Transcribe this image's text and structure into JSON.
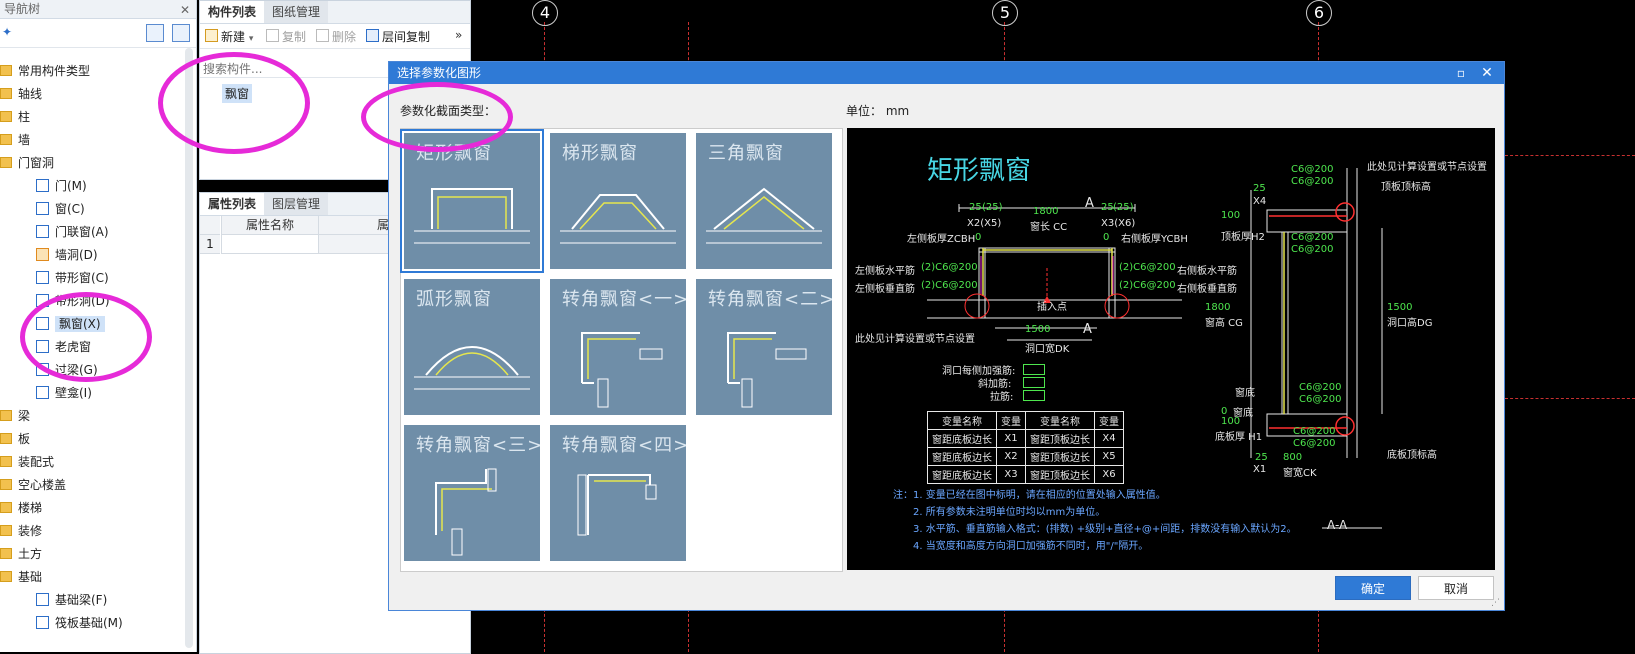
{
  "nav": {
    "title": "导航树",
    "tree": [
      {
        "label": "常用构件类型",
        "kind": "folder"
      },
      {
        "label": "轴线",
        "kind": "folder"
      },
      {
        "label": "柱",
        "kind": "folder"
      },
      {
        "label": "墙",
        "kind": "folder"
      },
      {
        "label": "门窗洞",
        "kind": "folder-open"
      },
      {
        "label": "门(M)",
        "kind": "item"
      },
      {
        "label": "窗(C)",
        "kind": "item"
      },
      {
        "label": "门联窗(A)",
        "kind": "item"
      },
      {
        "label": "墙洞(D)",
        "kind": "item-orange"
      },
      {
        "label": "带形窗(C)",
        "kind": "item"
      },
      {
        "label": "带形洞(D)",
        "kind": "item"
      },
      {
        "label": "飘窗(X)",
        "kind": "item",
        "selected": true
      },
      {
        "label": "老虎窗",
        "kind": "item"
      },
      {
        "label": "过梁(G)",
        "kind": "item"
      },
      {
        "label": "壁龛(I)",
        "kind": "item"
      },
      {
        "label": "梁",
        "kind": "folder"
      },
      {
        "label": "板",
        "kind": "folder"
      },
      {
        "label": "装配式",
        "kind": "folder"
      },
      {
        "label": "空心楼盖",
        "kind": "folder"
      },
      {
        "label": "楼梯",
        "kind": "folder"
      },
      {
        "label": "装修",
        "kind": "folder"
      },
      {
        "label": "土方",
        "kind": "folder"
      },
      {
        "label": "基础",
        "kind": "folder-open"
      },
      {
        "label": "基础梁(F)",
        "kind": "item"
      },
      {
        "label": "筏板基础(M)",
        "kind": "item"
      }
    ]
  },
  "component_panel": {
    "tabs": [
      "构件列表",
      "图纸管理"
    ],
    "toolbar": {
      "new": "新建",
      "copy": "复制",
      "delete": "删除",
      "floor_copy": "层间复制",
      "more": "»"
    },
    "search_placeholder": "搜索构件...",
    "items": [
      "飘窗"
    ]
  },
  "property_panel": {
    "tabs": [
      "属性列表",
      "图层管理"
    ],
    "columns": [
      "属性名称",
      "属性值"
    ],
    "rows": [
      {
        "index": "1",
        "name": "",
        "value": ""
      }
    ]
  },
  "cad": {
    "axes": [
      "4",
      "5",
      "6"
    ]
  },
  "dialog": {
    "title": "选择参数化图形",
    "section_label": "参数化截面类型：",
    "unit_label": "单位：",
    "unit_value": "mm",
    "shapes": [
      "矩形飘窗",
      "梯形飘窗",
      "三角飘窗",
      "弧形飘窗",
      "转角飘窗<一>",
      "转角飘窗<二>",
      "转角飘窗<三>",
      "转角飘窗<四>"
    ],
    "selected_shape": "矩形飘窗",
    "ok": "确定",
    "cancel": "取消",
    "preview": {
      "title": "矩形飘窗",
      "labels": {
        "left_thick": "左侧板厚ZCBH",
        "right_thick": "右侧板厚YCBH",
        "left_h_bar": "左侧板水平筋",
        "right_h_bar": "右侧板水平筋",
        "left_v_bar": "左侧板垂直筋",
        "right_v_bar": "右侧板垂直筋",
        "insert_point": "插入点",
        "calc_note_left": "此处见计算设置或节点设置",
        "calc_note_right": "此处见计算设置或节点设置",
        "window_len": "窗长 CC",
        "opening_width": "洞口宽DK",
        "top_slab_top": "顶板顶标高",
        "top_slab_thick": "顶板厚H2",
        "window_height": "窗高 CG",
        "opening_height": "洞口高DG",
        "bottom_slab_thick": "底板厚 H1",
        "bottom_slab_top": "底板顶标高",
        "window_width": "窗宽CK",
        "section": "A-A",
        "section_mark": "A",
        "reinforce_each": "洞口每侧加强筋:",
        "diag_bar": "斜加筋:",
        "tie_bar": "拉筋:",
        "bar_spec": "(2)C6@200",
        "bar_spec_short": "C6@200",
        "x1": "X1",
        "x2": "X2",
        "x3": "X3",
        "x4": "X4",
        "x5": "X5",
        "x6": "X6",
        "x2p": "X2(X5)",
        "x3p": "X3(X6)",
        "window_bottom": "窗底",
        "n25": "25",
        "n25p": "(25)",
        "n1800": "1800",
        "n1500": "1500",
        "n100": "100",
        "n800": "800",
        "n0": "0"
      },
      "table_header": [
        "变量名称",
        "变量",
        "变量名称",
        "变量"
      ],
      "table_rows": [
        [
          "窗距底板边长",
          "X1",
          "窗距顶板边长",
          "X4"
        ],
        [
          "窗距底板边长",
          "X2",
          "窗距顶板边长",
          "X5"
        ],
        [
          "窗距底板边长",
          "X3",
          "窗距顶板边长",
          "X6"
        ]
      ],
      "notes": [
        "注：1. 变量已经在图中标明，请在相应的位置处输入属性值。",
        "2. 所有参数未注明单位时均以mm为单位。",
        "3. 水平筋、垂直筋输入格式：(排数) +级别+直径+@+间距，排数没有输入默认为2。",
        "4. 当宽度和高度方向洞口加强筋不同时，用\"/\"隔开。"
      ]
    }
  }
}
